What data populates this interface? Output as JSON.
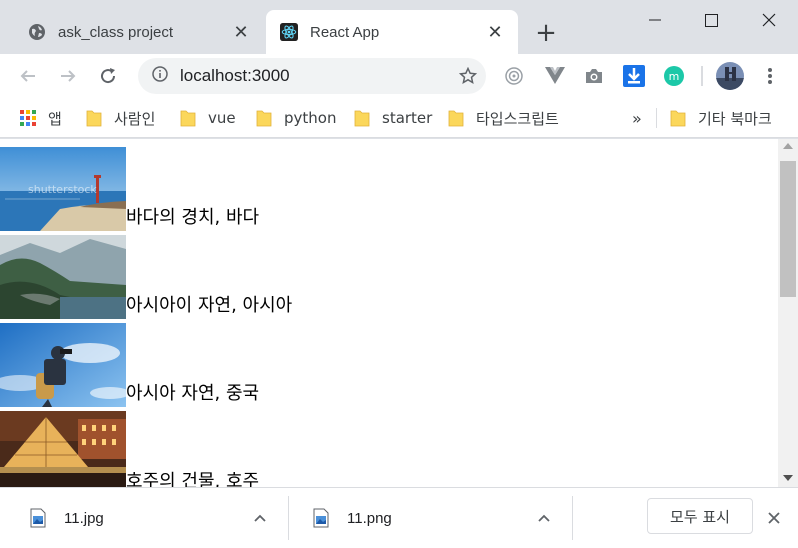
{
  "tabs": [
    {
      "title": "ask_class project",
      "active": false
    },
    {
      "title": "React App",
      "active": true
    }
  ],
  "address_bar": {
    "url": "localhost:3000"
  },
  "bookmarks": {
    "items": [
      "앱",
      "사람인",
      "vue",
      "python",
      "starter",
      "타입스크립트"
    ],
    "overflow": "»",
    "other": "기타 북마크"
  },
  "page": {
    "items": [
      {
        "caption": "바다의 경치, 바다",
        "watermark": "shutterstock"
      },
      {
        "caption": "아시아이 자연, 아시아"
      },
      {
        "caption": "아시아 자연, 중국"
      },
      {
        "caption": "호주의 건물, 호주"
      }
    ]
  },
  "downloads": {
    "files": [
      "11.jpg",
      "11.png"
    ],
    "show_all": "모두 표시"
  },
  "colors": {
    "accent_blue": "#1a73e8",
    "folder_yellow": "#fbd75b"
  }
}
